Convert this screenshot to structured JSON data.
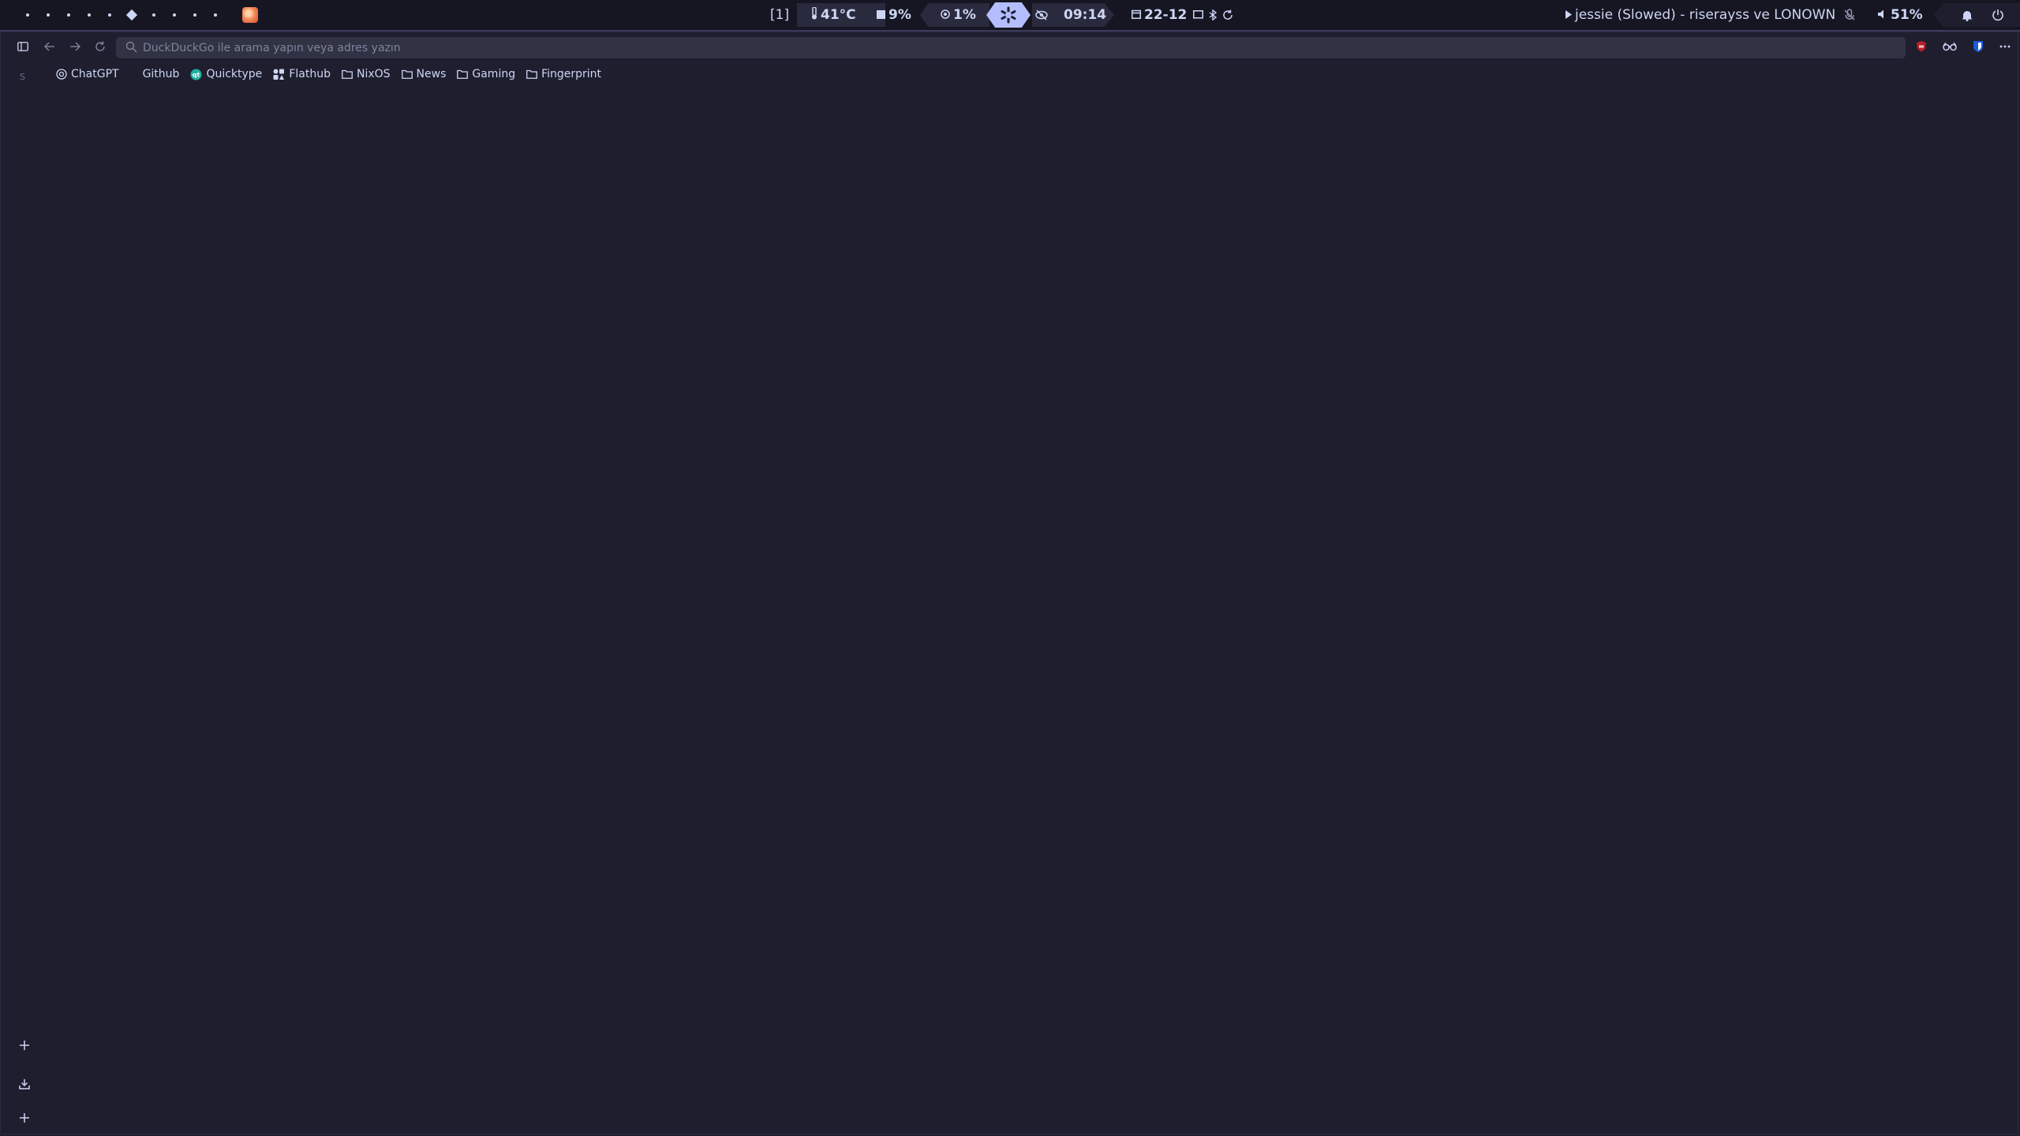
{
  "topbar": {
    "workspace_label": "[1]",
    "temperature": "41°C",
    "memory": "9%",
    "cpu": "1%",
    "time": "09:14",
    "date": "22-12",
    "media": "jessie (Slowed) - riserayss ve LONOWN",
    "volume": "51%"
  },
  "browser": {
    "search_placeholder": "DuckDuckGo ile arama yapın veya adres yazın",
    "sidebar_letter": "S",
    "bookmarks": [
      {
        "label": "ChatGPT",
        "icon": "chatgpt-icon"
      },
      {
        "label": "Github",
        "icon": "github-icon"
      },
      {
        "label": "Quicktype",
        "icon": "quicktype-icon"
      },
      {
        "label": "Flathub",
        "icon": "flathub-icon"
      },
      {
        "label": "NixOS",
        "icon": "folder-icon"
      },
      {
        "label": "News",
        "icon": "folder-icon"
      },
      {
        "label": "Gaming",
        "icon": "folder-icon"
      },
      {
        "label": "Fingerprint",
        "icon": "folder-icon"
      }
    ]
  },
  "colors": {
    "background": "#1e1e2e",
    "bar": "#161622",
    "accent": "#b4befe",
    "urlbar": "#313244"
  }
}
